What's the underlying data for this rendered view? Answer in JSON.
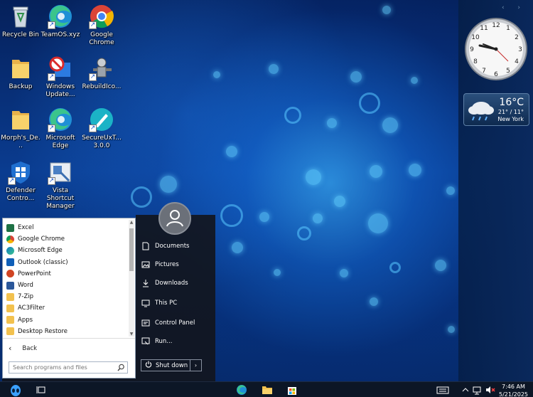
{
  "desktop": {
    "icons": [
      {
        "label": "Recycle Bin",
        "icon": "recycle-bin-icon"
      },
      {
        "label": "TeamOS.xyz",
        "icon": "edge-icon"
      },
      {
        "label": "Google Chrome",
        "icon": "chrome-icon"
      },
      {
        "label": "Backup",
        "icon": "folder-icon"
      },
      {
        "label": "Windows Update...",
        "icon": "windows-update-icon"
      },
      {
        "label": "RebuildIco...",
        "icon": "rebuild-icon"
      },
      {
        "label": "Morph's_De...",
        "icon": "folder-icon"
      },
      {
        "label": "Microsoft Edge",
        "icon": "edge-icon"
      },
      {
        "label": "SecureUxT... 3.0.0",
        "icon": "secure-ux-icon"
      },
      {
        "label": "Defender Contro...",
        "icon": "defender-icon"
      },
      {
        "label": "Vista Shortcut Manager",
        "icon": "vista-shortcut-icon"
      }
    ]
  },
  "sidebar": {
    "weather": {
      "temp": "16°C",
      "range": "21° / 11°",
      "city": "New York"
    }
  },
  "start_menu": {
    "programs": [
      {
        "label": "Excel",
        "icon": "excel-icon",
        "color": "#1e7145"
      },
      {
        "label": "Google Chrome",
        "icon": "chrome-icon",
        "color": "#db4437"
      },
      {
        "label": "Microsoft Edge",
        "icon": "edge-icon",
        "color": "#0f7bc4"
      },
      {
        "label": "Outlook (classic)",
        "icon": "outlook-icon",
        "color": "#0f5fb8"
      },
      {
        "label": "PowerPoint",
        "icon": "powerpoint-icon",
        "color": "#d04423"
      },
      {
        "label": "Word",
        "icon": "word-icon",
        "color": "#2b579a"
      },
      {
        "label": "7-Zip",
        "icon": "folder-icon",
        "color": "#f2c14e"
      },
      {
        "label": "AC3Filter",
        "icon": "folder-icon",
        "color": "#f2c14e"
      },
      {
        "label": "Apps",
        "icon": "apps-folder-icon",
        "color": "#f2c14e"
      },
      {
        "label": "Desktop Restore",
        "icon": "folder-icon",
        "color": "#f2c14e"
      }
    ],
    "back_label": "Back",
    "search_placeholder": "Search programs and files",
    "places": [
      {
        "label": "Documents",
        "icon": "document-icon"
      },
      {
        "label": "Pictures",
        "icon": "picture-icon"
      },
      {
        "label": "Downloads",
        "icon": "download-icon"
      },
      {
        "label": "This PC",
        "icon": "computer-icon"
      },
      {
        "label": "Control Panel",
        "icon": "control-panel-icon"
      },
      {
        "label": "Run...",
        "icon": "run-icon"
      }
    ],
    "shutdown_label": "Shut down"
  },
  "taskbar": {
    "time": "7:46 AM",
    "date": "5/21/2025"
  }
}
